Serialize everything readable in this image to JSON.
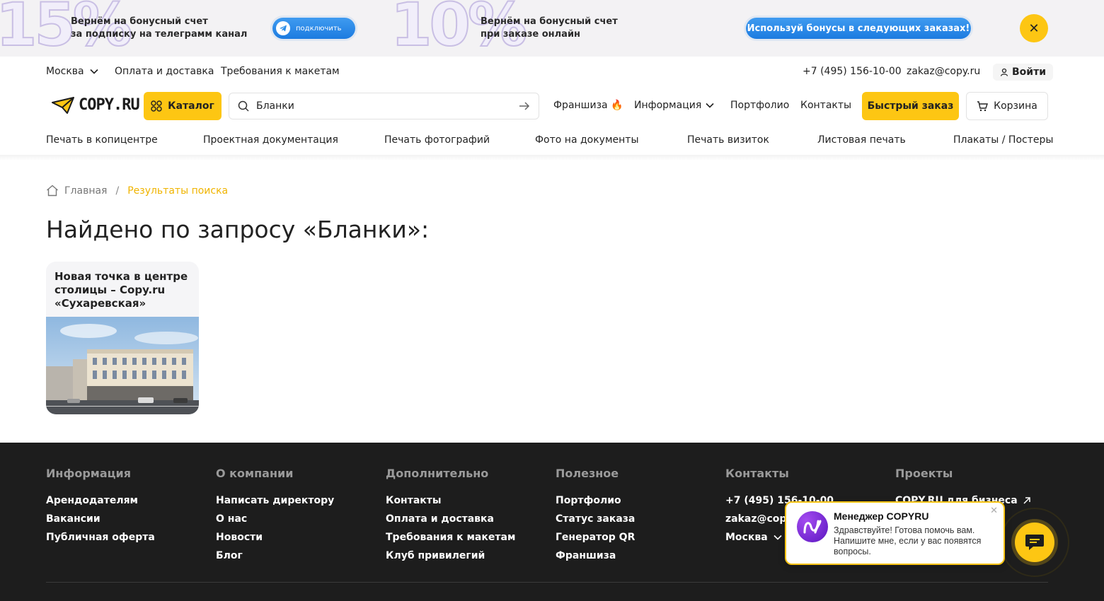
{
  "promo": {
    "big1": "15%",
    "text1_line1": "Вернём на бонусный счет",
    "text1_line2": "за подписку на телеграмм канал",
    "tg_button": "подключить",
    "big2": "10%",
    "text2_line1": "Вернём на бонусный счет",
    "text2_line2": "при заказе онлайн",
    "bonus_button": "Используй бонусы в следующих заказах!",
    "close_icon": "close-icon"
  },
  "topbar": {
    "city": "Москва",
    "links": [
      "Оплата и доставка",
      "Требования к макетам"
    ],
    "phone": "+7 (495) 156-10-00",
    "email": "zakaz@copy.ru",
    "login": "Войти"
  },
  "header": {
    "logo": "COPY.RU",
    "catalog": "Каталог",
    "search_value": "Бланки",
    "nav": [
      "Франшиза 🔥",
      "Информация",
      "Портфолио",
      "Контакты"
    ],
    "quick_order": "Быстрый заказ",
    "cart": "Корзина"
  },
  "categories": [
    "Печать в копицентре",
    "Проектная документация",
    "Печать фотографий",
    "Фото на документы",
    "Печать визиток",
    "Листовая печать",
    "Плакаты / Постеры"
  ],
  "breadcrumb": {
    "home": "Главная",
    "current": "Результаты поиска"
  },
  "page_title": "Найдено по запросу «Бланки»:",
  "result_card": {
    "title": "Новая точка в центре столицы – Copy.ru «Сухаревская»"
  },
  "footer": {
    "columns": [
      {
        "heading": "Информация",
        "items": [
          "Арендодателям",
          "Вакансии",
          "Публичная оферта"
        ]
      },
      {
        "heading": "О компании",
        "items": [
          "Написать директору",
          "О нас",
          "Новости",
          "Блог"
        ]
      },
      {
        "heading": "Дополнительно",
        "items": [
          "Контакты",
          "Оплата и доставка",
          "Требования к макетам",
          "Клуб привилегий"
        ]
      },
      {
        "heading": "Полезное",
        "items": [
          "Портфолио",
          "Статус заказа",
          "Генератор QR",
          "Франшиза"
        ]
      },
      {
        "heading": "Контакты",
        "items": [
          "+7 (495) 156-10-00",
          "zakaz@copy",
          "Москва"
        ]
      },
      {
        "heading": "Проекты",
        "items": [
          "COPY.RU для бизнеса"
        ]
      }
    ]
  },
  "chat": {
    "name": "Менеджер COPYRU",
    "message": "Здравствуйте! Готова помочь вам. Напишите мне, если у вас появятся вопросы."
  },
  "colors": {
    "accent": "#fdc613",
    "footer_bg": "#1d1d1d",
    "promo_blue": "#1c7be0"
  }
}
